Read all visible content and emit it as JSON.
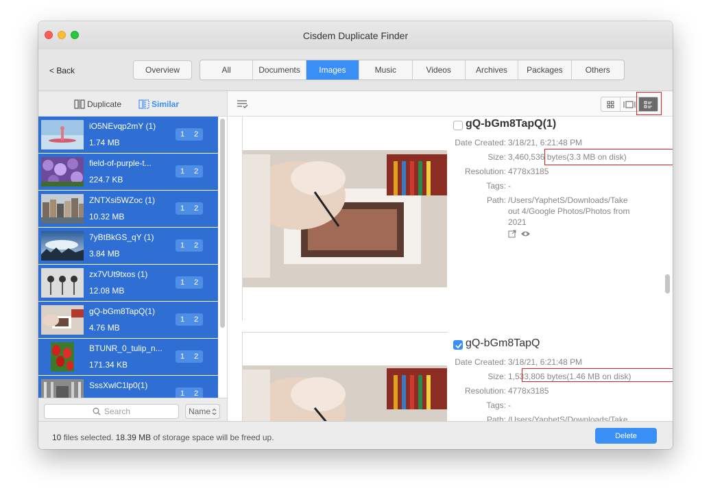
{
  "window": {
    "title": "Cisdem Duplicate Finder"
  },
  "toolbar": {
    "back_label": "< Back",
    "overview_label": "Overview",
    "tabs": [
      "All",
      "Documents",
      "Images",
      "Music",
      "Videos",
      "Archives",
      "Packages",
      "Others"
    ],
    "active_tab": "Images"
  },
  "sidebar": {
    "modes": {
      "duplicate": "Duplicate",
      "similar": "Similar",
      "active": "Similar"
    },
    "items": [
      {
        "name": "iO5NEvqp2mY (1)",
        "size": "1.74 MB",
        "badges": [
          "1",
          "2"
        ],
        "thumb": "drop-icon"
      },
      {
        "name": "field-of-purple-t...",
        "size": "224.7 KB",
        "badges": [
          "1",
          "2"
        ],
        "thumb": "flowers-icon"
      },
      {
        "name": "ZNTXsi5WZoc (1)",
        "size": "10.32 MB",
        "badges": [
          "1",
          "2"
        ],
        "thumb": "city-icon"
      },
      {
        "name": "7yBtBkGS_qY (1)",
        "size": "3.84 MB",
        "badges": [
          "1",
          "2"
        ],
        "thumb": "sky-icon"
      },
      {
        "name": "zx7VUt9txos (1)",
        "size": "12.08 MB",
        "badges": [
          "1",
          "2"
        ],
        "thumb": "lamps-icon"
      },
      {
        "name": "gQ-bGm8TapQ(1)",
        "size": "4.76 MB",
        "badges": [
          "1",
          "2"
        ],
        "thumb": "drawing-icon"
      },
      {
        "name": "BTUNR_0_tulip_n...",
        "size": "171.34 KB",
        "badges": [
          "1",
          "2"
        ],
        "thumb": "tulip-icon"
      },
      {
        "name": "SssXwlC1lp0(1)",
        "size": "",
        "badges": [
          "1",
          "2"
        ],
        "thumb": "hall-icon"
      }
    ],
    "search_placeholder": "Search",
    "sort_label": "Name"
  },
  "main": {
    "files": [
      {
        "name": "gQ-bGm8TapQ(1)",
        "checked": false,
        "details": [
          {
            "label": "Date Created:",
            "value": "3/18/21, 6:21:48 PM"
          },
          {
            "label": "Size:",
            "value": "3,460,536 bytes(3.3 MB on disk)"
          },
          {
            "label": "Resolution:",
            "value": "4778x3185"
          },
          {
            "label": "Tags:",
            "value": "-"
          },
          {
            "label": "Path:",
            "value_lines": [
              "/Users/YaphetS/Downloads/Take",
              "out 4/Google Photos/Photos from",
              "2021"
            ]
          }
        ]
      },
      {
        "name": "gQ-bGm8TapQ",
        "checked": true,
        "details": [
          {
            "label": "Date Created:",
            "value": "3/18/21, 6:21:48 PM"
          },
          {
            "label": "Size:",
            "value": "1,533,806 bytes(1.46 MB on disk)"
          },
          {
            "label": "Resolution:",
            "value": "4778x3185"
          },
          {
            "label": "Tags:",
            "value": "-"
          },
          {
            "label": "Path:",
            "value_lines": [
              "/Users/YaphetS/Downloads/Take"
            ]
          }
        ]
      }
    ]
  },
  "status": {
    "count": "10",
    "text1": " files selected. ",
    "freed": "18.39 MB",
    "text2": " of storage space will be freed up."
  },
  "delete_label": "Delete",
  "colors": {
    "accent": "#3a8ff7",
    "list_selected": "#2f6fd3",
    "highlight": "#e02020"
  }
}
